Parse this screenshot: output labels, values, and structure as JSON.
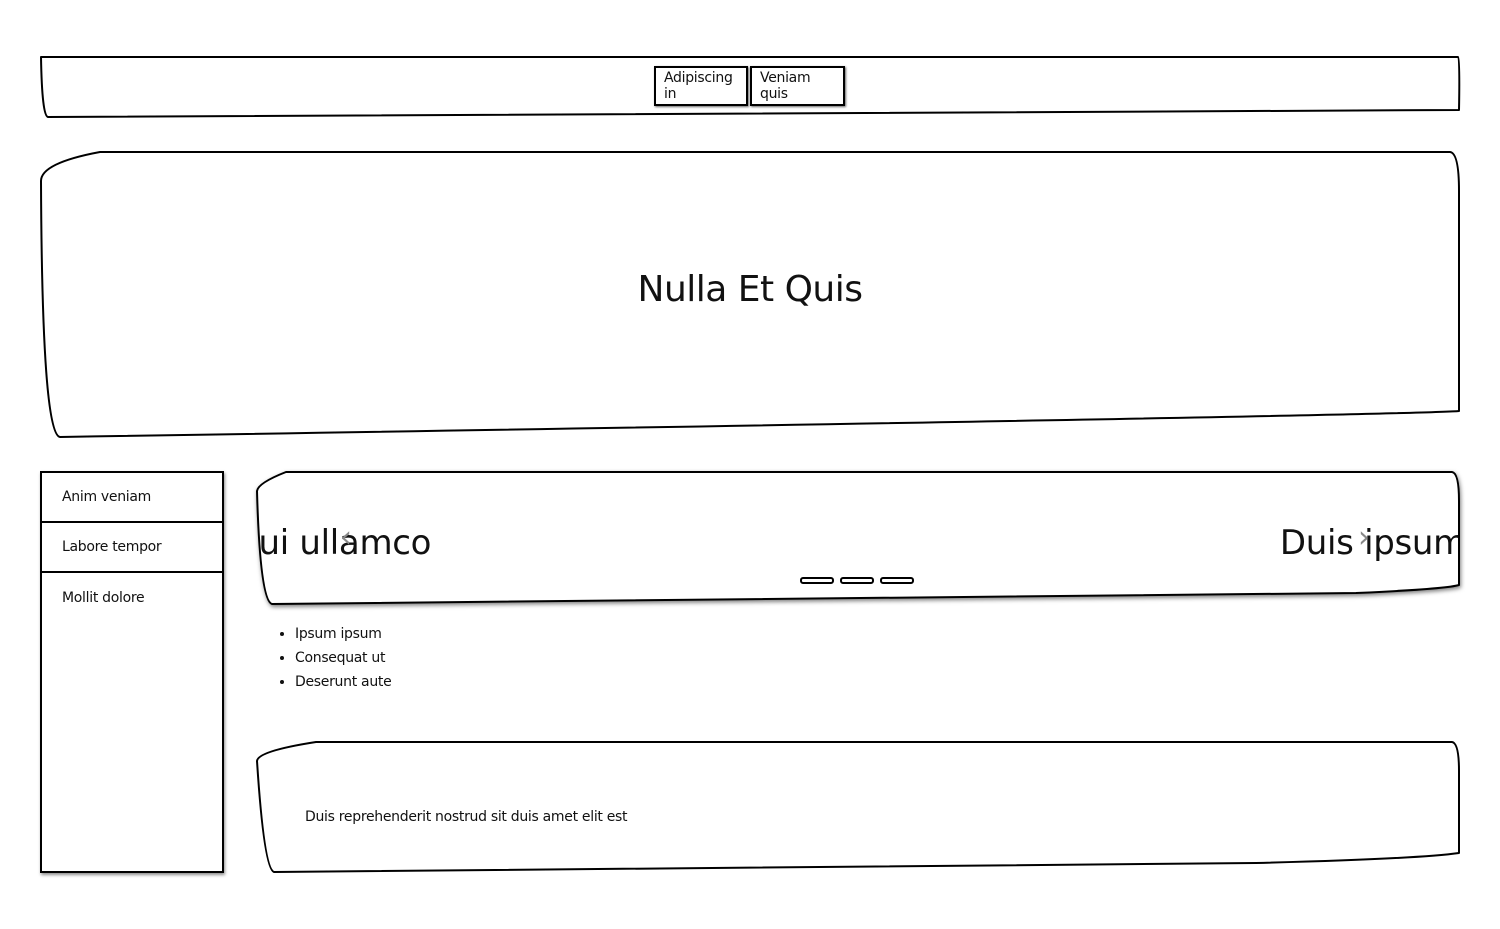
{
  "header": {
    "nav": [
      {
        "label": "Adipiscing in"
      },
      {
        "label": "Veniam quis"
      }
    ]
  },
  "hero": {
    "title": "Nulla Et Quis"
  },
  "sidebar": {
    "items": [
      {
        "label": "Anim veniam"
      },
      {
        "label": "Labore tempor"
      },
      {
        "label": "Mollit dolore"
      }
    ]
  },
  "carousel": {
    "prev_slide_text": "Qui ullamco",
    "next_slide_text": "Duis ipsum",
    "prev_arrow_icon": "chevron-left-icon",
    "next_arrow_icon": "chevron-right-icon",
    "indicator_count": 3
  },
  "list": {
    "items": [
      "Ipsum ipsum",
      "Consequat ut",
      "Deserunt aute"
    ]
  },
  "footer": {
    "text": "Duis reprehenderit nostrud sit duis amet elit est"
  }
}
